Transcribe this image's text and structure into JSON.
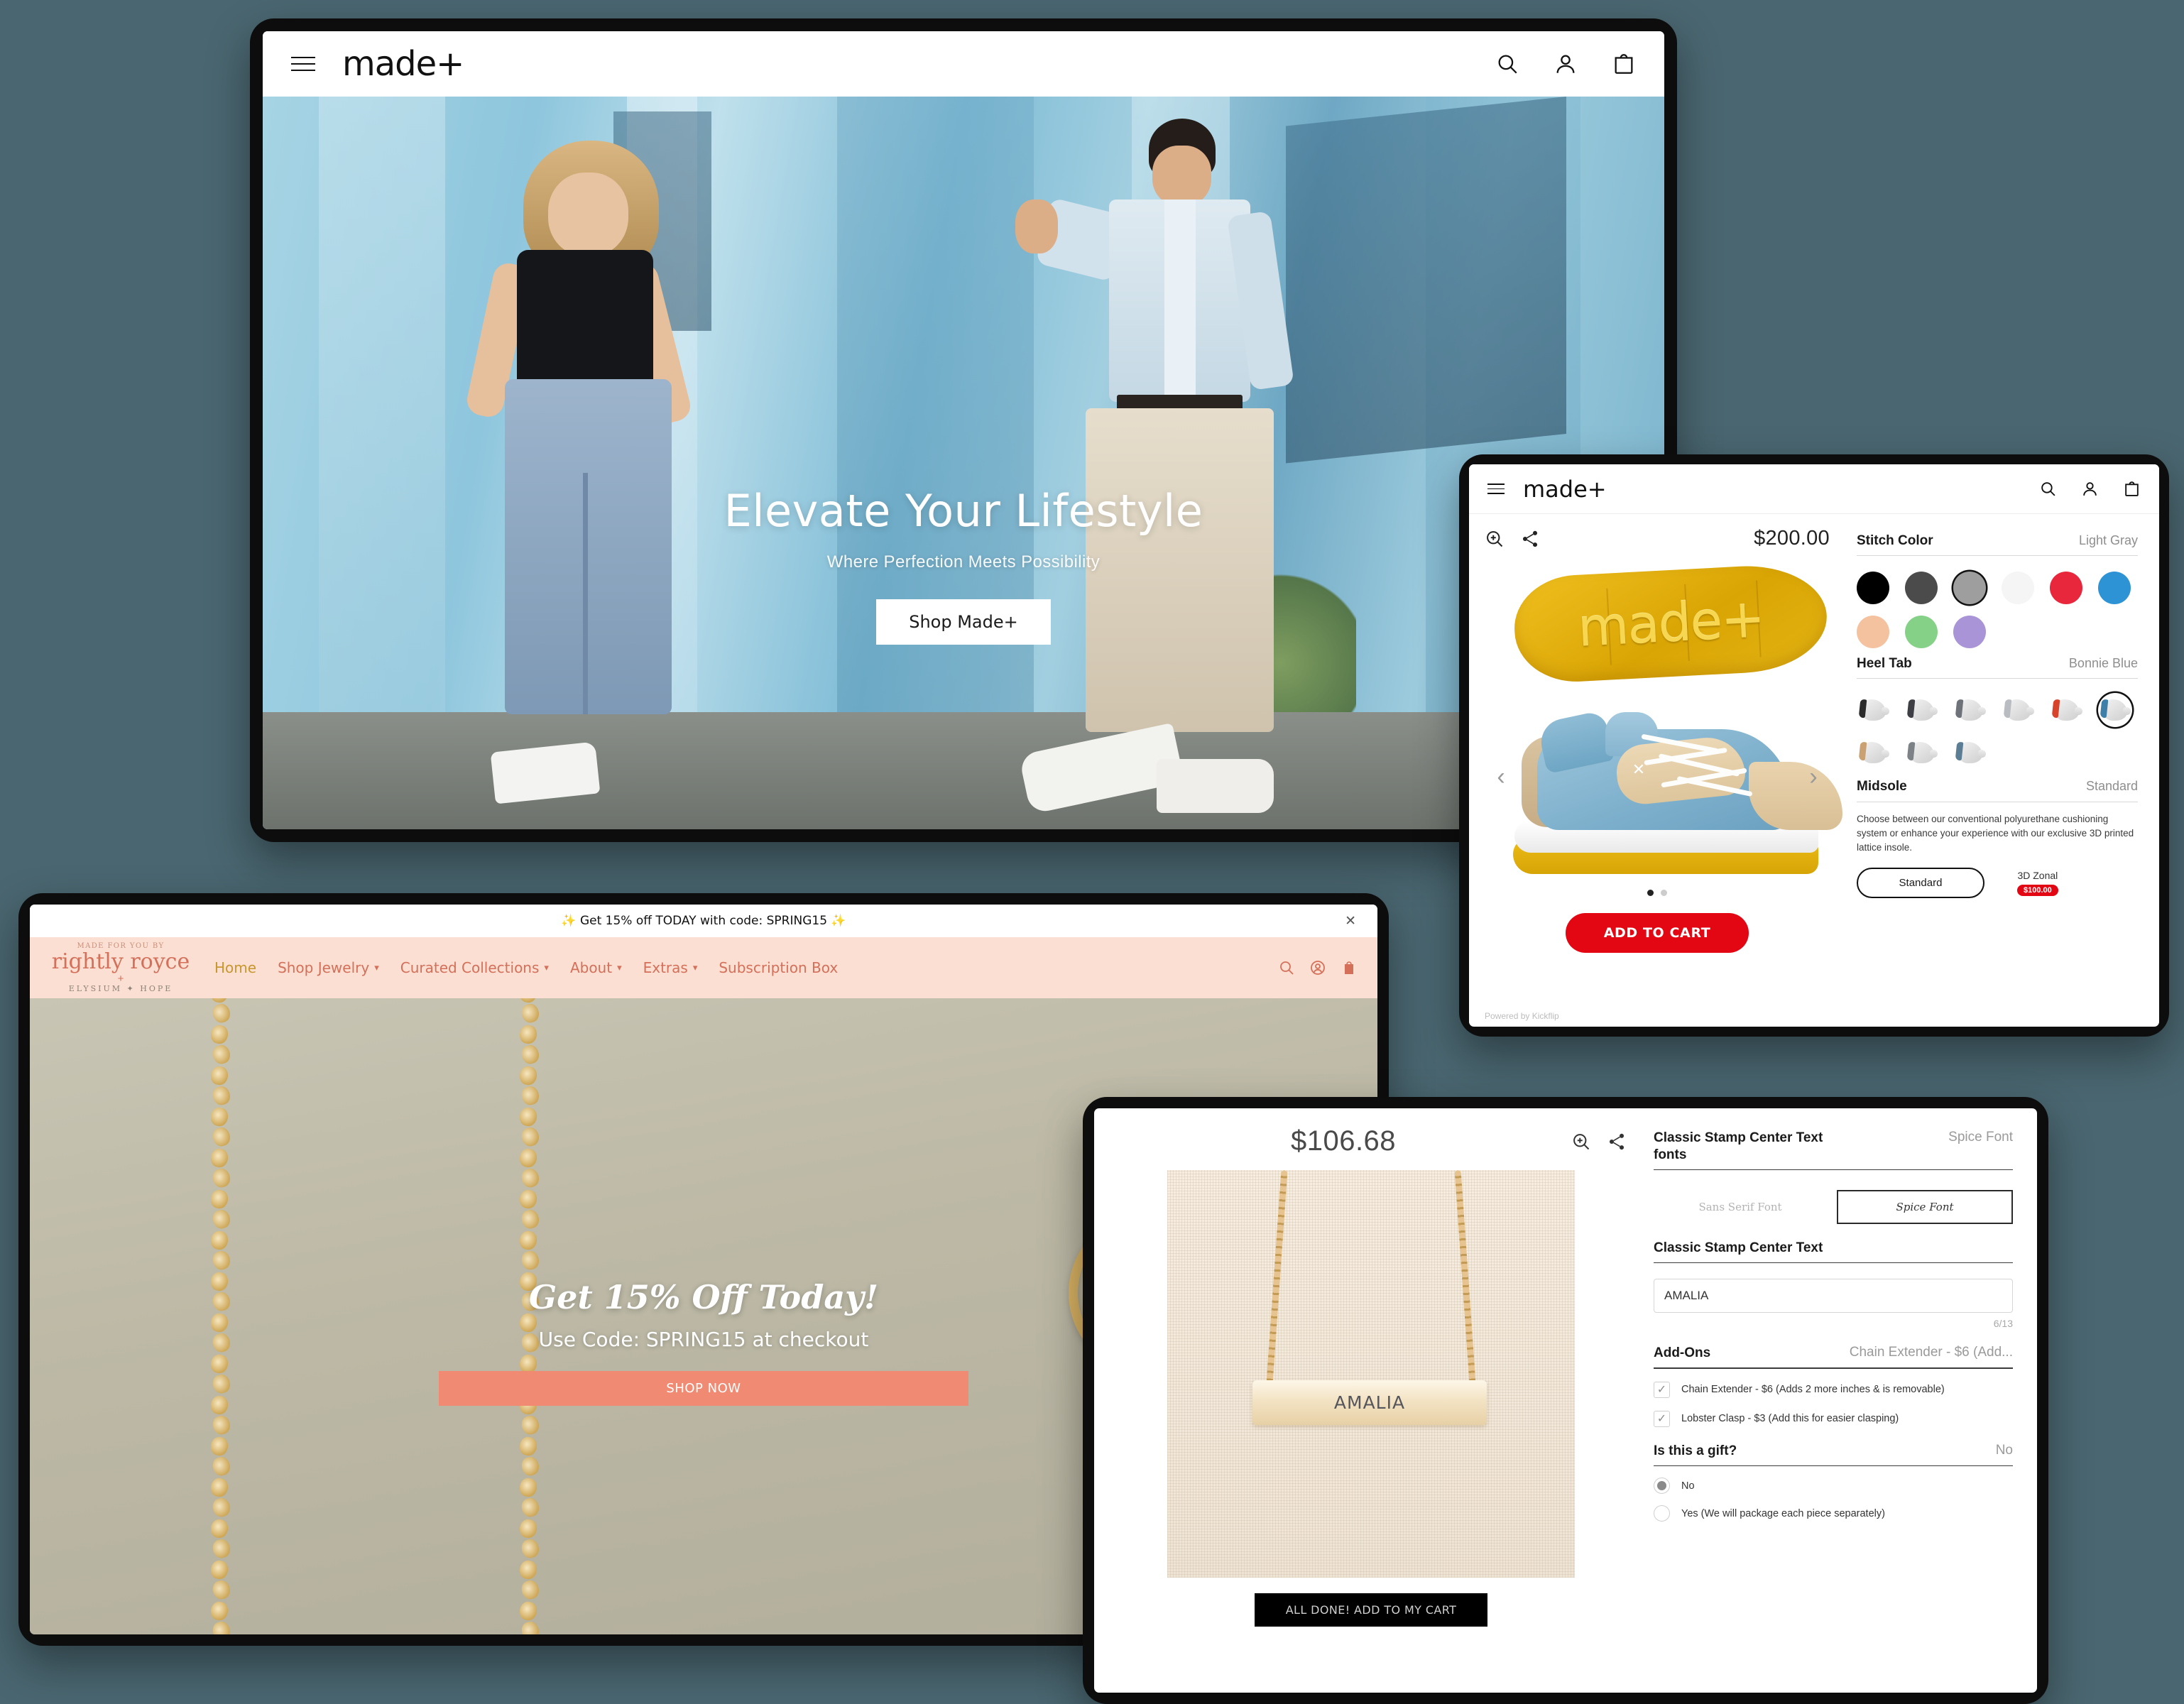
{
  "background_color": "#4a6670",
  "store": {
    "brand": "made+",
    "icons": {
      "menu": "hamburger-icon",
      "search": "search-icon",
      "account": "user-icon",
      "cart": "cart-icon"
    },
    "hero": {
      "title": "Elevate Your Lifestyle",
      "subtitle": "Where Perfection Meets Possibility",
      "cta": "Shop Made+"
    }
  },
  "shoe_configurator": {
    "brand": "made+",
    "price": "$200.00",
    "tools": {
      "zoom": "zoom-in-icon",
      "share": "share-icon"
    },
    "product_logo": "made+",
    "nav": {
      "prev": "‹",
      "next": "›"
    },
    "cta": "ADD TO CART",
    "powered_by": "Powered by Kickflip",
    "options": [
      {
        "title": "Stitch Color",
        "value": "Light Gray",
        "swatches": [
          {
            "name": "Black",
            "color": "#000000"
          },
          {
            "name": "Dark Gray",
            "color": "#4b4b4b"
          },
          {
            "name": "Light Gray",
            "color": "#9e9e9e",
            "selected": true
          },
          {
            "name": "White",
            "color": "#f5f5f5"
          },
          {
            "name": "Red",
            "color": "#e8273c"
          },
          {
            "name": "Blue",
            "color": "#2e93d4"
          },
          {
            "name": "Peach",
            "color": "#f5c2a0"
          },
          {
            "name": "Green",
            "color": "#86d188"
          },
          {
            "name": "Purple",
            "color": "#a894d6"
          }
        ]
      },
      {
        "title": "Heel Tab",
        "value": "Bonnie Blue",
        "swatches": [
          {
            "name": "Black",
            "color": "#2b2b2b"
          },
          {
            "name": "Charcoal",
            "color": "#3d3f45"
          },
          {
            "name": "Slate",
            "color": "#6e737a"
          },
          {
            "name": "Silver",
            "color": "#b9bcc0"
          },
          {
            "name": "Red",
            "color": "#d8432c"
          },
          {
            "name": "Bonnie Blue",
            "color": "#3d7fa8",
            "selected": true
          },
          {
            "name": "Tan",
            "color": "#c9a173"
          },
          {
            "name": "Gray",
            "color": "#7d8287"
          },
          {
            "name": "Steel Blue",
            "color": "#5b7e95"
          }
        ]
      },
      {
        "title": "Midsole",
        "value": "Standard",
        "description": "Choose between our conventional polyurethane cushioning system or enhance your experience with our exclusive 3D printed lattice insole.",
        "choices": [
          {
            "label": "Standard",
            "selected": true
          },
          {
            "label": "3D Zonal",
            "badge": "$100.00"
          }
        ]
      }
    ]
  },
  "jewelry_store": {
    "promo": "✨ Get 15% off TODAY with code: SPRING15 ✨",
    "promo_close": "✕",
    "logo": {
      "eyebrow": "MADE FOR YOU BY",
      "name": "rightly royce",
      "plus": "+",
      "partner": "ELYSIUM ✦ HOPE"
    },
    "nav_links": [
      {
        "label": "Home",
        "active": true,
        "caret": false
      },
      {
        "label": "Shop Jewelry",
        "active": false,
        "caret": true
      },
      {
        "label": "Curated Collections",
        "active": false,
        "caret": true
      },
      {
        "label": "About",
        "active": false,
        "caret": true
      },
      {
        "label": "Extras",
        "active": false,
        "caret": true
      },
      {
        "label": "Subscription Box",
        "active": false,
        "caret": false
      }
    ],
    "icons": {
      "search": "search-icon",
      "account": "user-icon",
      "cart": "bag-icon"
    },
    "hero": {
      "title": "Get 15% Off Today!",
      "subtitle": "Use Code: SPRING15 at checkout",
      "cta": "SHOP NOW"
    },
    "accent_color": "#d4705a",
    "button_color": "#f08a72"
  },
  "necklace_configurator": {
    "price": "$106.68",
    "tools": {
      "zoom": "zoom-in-icon",
      "share": "share-icon"
    },
    "engraving_preview": "AMALIA",
    "cta": "ALL DONE! ADD TO MY CART",
    "options": [
      {
        "title": "Classic Stamp Center Text fonts",
        "value": "Spice Font",
        "choices": [
          {
            "label": "Sans Serif Font",
            "selected": false
          },
          {
            "label": "Spice Font",
            "selected": true
          }
        ]
      },
      {
        "title": "Classic Stamp Center Text",
        "input_value": "AMALIA",
        "counter": "6/13"
      },
      {
        "title": "Add-Ons",
        "value": "Chain Extender - $6 (Add...",
        "checkboxes": [
          {
            "label": "Chain Extender - $6 (Adds 2 more inches & is removable)",
            "checked": true
          },
          {
            "label": "Lobster Clasp - $3 (Add this for easier clasping)",
            "checked": true
          }
        ]
      },
      {
        "title": "Is this a gift?",
        "value": "No",
        "radios": [
          {
            "label": "No",
            "selected": true
          },
          {
            "label": "Yes (We will package each piece separately)",
            "selected": false
          }
        ]
      }
    ]
  }
}
